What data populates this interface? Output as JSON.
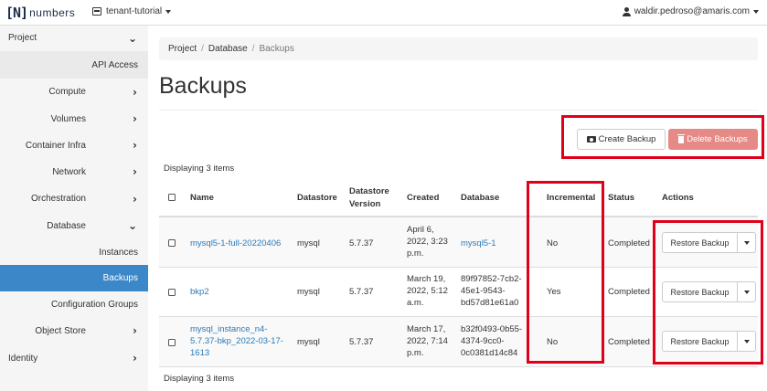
{
  "navbar": {
    "logo_bracket": "[N]",
    "logo_text": "numbers",
    "project": "tenant-tutorial",
    "user": "waldir.pedroso@amaris.com"
  },
  "sidebar": {
    "project": "Project",
    "api_access": "API Access",
    "compute": "Compute",
    "volumes": "Volumes",
    "container_infra": "Container Infra",
    "network": "Network",
    "orchestration": "Orchestration",
    "database": "Database",
    "instances": "Instances",
    "backups": "Backups",
    "configuration_groups": "Configuration Groups",
    "object_store": "Object Store",
    "identity": "Identity"
  },
  "breadcrumb": {
    "project": "Project",
    "database": "Database",
    "current": "Backups",
    "separator": "/"
  },
  "page": {
    "title": "Backups",
    "create_button": "Create Backup",
    "delete_button": "Delete Backups",
    "count_top": "Displaying 3 items",
    "count_bottom": "Displaying 3 items"
  },
  "table": {
    "headers": {
      "name": "Name",
      "datastore": "Datastore",
      "datastore_version_1": "Datastore",
      "datastore_version_2": "Version",
      "created": "Created",
      "database": "Database",
      "incremental": "Incremental",
      "status": "Status",
      "actions": "Actions"
    },
    "rows": [
      {
        "name": "mysql5-1-full-20220406",
        "datastore": "mysql",
        "version": "5.7.37",
        "created_1": "April 6,",
        "created_2": "2022, 3:23",
        "created_3": "p.m.",
        "database": "mysql5-1",
        "incremental": "No",
        "status": "Completed",
        "action": "Restore Backup"
      },
      {
        "name": "bkp2",
        "datastore": "mysql",
        "version": "5.7.37",
        "created_1": "March 19,",
        "created_2": "2022, 5:12",
        "created_3": "a.m.",
        "database_1": "89f97852-7cb2-",
        "database_2": "45e1-9543-",
        "database_3": "bd57d81e61a0",
        "incremental": "Yes",
        "status": "Completed",
        "action": "Restore Backup"
      },
      {
        "name_1": "mysql_instance_n4-",
        "name_2": "5.7.37-bkp_2022-03-17-",
        "name_3": "1613",
        "datastore": "mysql",
        "version": "5.7.37",
        "created_1": "March 17,",
        "created_2": "2022, 7:14",
        "created_3": "p.m.",
        "database_1": "b32f0493-0b55-",
        "database_2": "4374-9cc0-",
        "database_3": "0c0381d14c84",
        "incremental": "No",
        "status": "Completed",
        "action": "Restore Backup"
      }
    ]
  },
  "colors": {
    "highlight": "#e0001a",
    "active_nav": "#3b87c8",
    "link": "#2a7ab8",
    "danger": "#e58a87"
  }
}
